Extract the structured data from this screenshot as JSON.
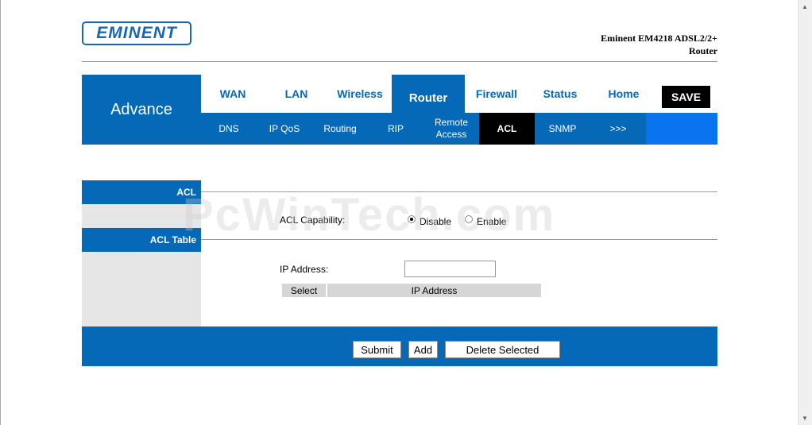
{
  "brand": {
    "logo_text": "EMINENT",
    "model_line1": "Eminent EM4218 ADSL2/2+",
    "model_line2": "Router"
  },
  "section_title": "Advance",
  "top_tabs": [
    {
      "label": "WAN",
      "active": false
    },
    {
      "label": "LAN",
      "active": false
    },
    {
      "label": "Wireless",
      "active": false
    },
    {
      "label": "Router",
      "active": true
    },
    {
      "label": "Firewall",
      "active": false
    },
    {
      "label": "Status",
      "active": false
    },
    {
      "label": "Home",
      "active": false
    }
  ],
  "save_label": "SAVE",
  "sub_tabs": [
    {
      "label": "DNS",
      "active": false
    },
    {
      "label": "IP QoS",
      "active": false
    },
    {
      "label": "Routing",
      "active": false
    },
    {
      "label": "RIP",
      "active": false
    },
    {
      "label": "Remote Access",
      "active": false
    },
    {
      "label": "ACL",
      "active": true
    },
    {
      "label": "SNMP",
      "active": false
    },
    {
      "label": ">>>",
      "active": false
    }
  ],
  "sidebar": {
    "acl_heading": "ACL",
    "acl_table_heading": "ACL Table"
  },
  "acl_capability": {
    "label": "ACL Capability:",
    "options": [
      "Disable",
      "Enable"
    ],
    "selected": "Disable"
  },
  "ip_address": {
    "label": "IP Address:",
    "value": ""
  },
  "table": {
    "columns": [
      "Select",
      "IP Address"
    ],
    "rows": []
  },
  "buttons": {
    "submit": "Submit",
    "add": "Add",
    "delete_selected": "Delete Selected"
  },
  "watermark": "PcWinTech.com",
  "colors": {
    "primary": "#0569b8",
    "active_sub": "#000000",
    "sidebar_grey": "#e6e6e6"
  }
}
